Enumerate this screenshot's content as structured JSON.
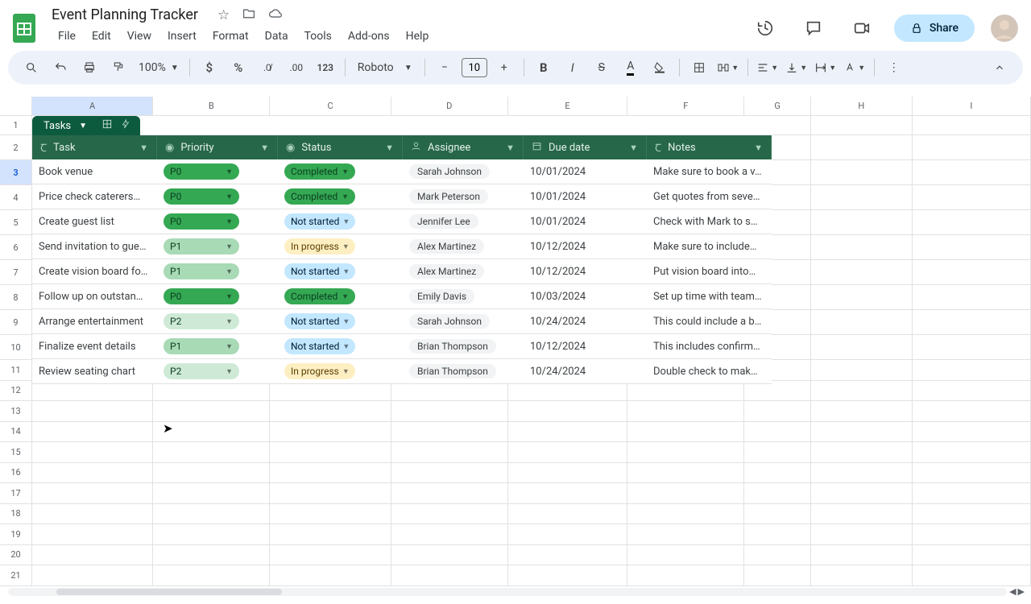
{
  "doc": {
    "title": "Event Planning Tracker"
  },
  "menubar": [
    "File",
    "Edit",
    "View",
    "Insert",
    "Format",
    "Data",
    "Tools",
    "Add-ons",
    "Help"
  ],
  "header_right": {
    "share": "Share"
  },
  "toolbar": {
    "zoom": "100%",
    "font": "Roboto",
    "font_size": "10"
  },
  "col_letters": [
    "A",
    "B",
    "C",
    "D",
    "E",
    "F",
    "G",
    "H",
    "I"
  ],
  "row_numbers": [
    "1",
    "2",
    "3",
    "4",
    "5",
    "6",
    "7",
    "8",
    "9",
    "10",
    "11",
    "12",
    "13",
    "14",
    "15",
    "16",
    "17",
    "18",
    "19",
    "20",
    "21"
  ],
  "table": {
    "tab_name": "Tasks",
    "columns": [
      {
        "icon": "text",
        "label": "Task"
      },
      {
        "icon": "chip",
        "label": "Priority"
      },
      {
        "icon": "chip",
        "label": "Status"
      },
      {
        "icon": "person",
        "label": "Assignee"
      },
      {
        "icon": "date",
        "label": "Due date"
      },
      {
        "icon": "text",
        "label": "Notes"
      }
    ],
    "rows": [
      {
        "task": "Book venue",
        "priority": "P0",
        "status": "Completed",
        "assignee": "Sarah Johnson",
        "due": "10/01/2024",
        "notes": "Make sure to book a v…"
      },
      {
        "task": "Price check caterers…",
        "priority": "P0",
        "status": "Completed",
        "assignee": "Mark Peterson",
        "due": "10/01/2024",
        "notes": "Get quotes from seve…"
      },
      {
        "task": "Create guest list",
        "priority": "P0",
        "status": "Not started",
        "assignee": "Jennifer Lee",
        "due": "10/01/2024",
        "notes": "Check with Mark to s…"
      },
      {
        "task": "Send invitation to gue…",
        "priority": "P1",
        "status": "In progress",
        "assignee": "Alex Martinez",
        "due": "10/12/2024",
        "notes": "Make sure to include…"
      },
      {
        "task": "Create vision board fo…",
        "priority": "P1",
        "status": "Not started",
        "assignee": "Alex Martinez",
        "due": "10/12/2024",
        "notes": "Put vision board into…"
      },
      {
        "task": "Follow up on outstan…",
        "priority": "P0",
        "status": "Completed",
        "assignee": "Emily Davis",
        "due": "10/03/2024",
        "notes": "Set up time with team…"
      },
      {
        "task": "Arrange entertainment",
        "priority": "P2",
        "status": "Not started",
        "assignee": "Sarah Johnson",
        "due": "10/24/2024",
        "notes": "This could include a b…"
      },
      {
        "task": "Finalize event details",
        "priority": "P1",
        "status": "Not started",
        "assignee": "Brian Thompson",
        "due": "10/12/2024",
        "notes": "This includes confirm…"
      },
      {
        "task": "Review seating chart",
        "priority": "P2",
        "status": "In progress",
        "assignee": "Brian Thompson",
        "due": "10/24/2024",
        "notes": "Double check to mak…"
      }
    ]
  }
}
